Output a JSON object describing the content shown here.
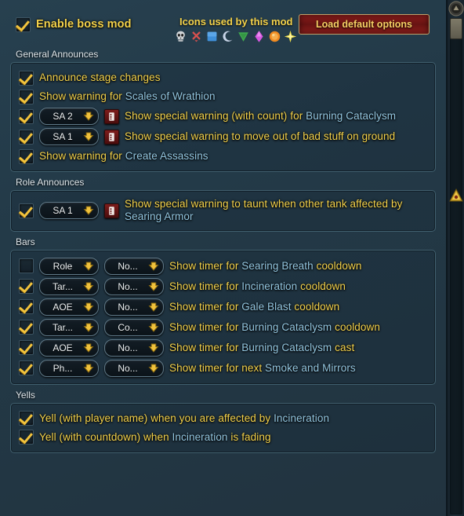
{
  "topbar": {
    "enable_label": "Enable boss mod",
    "enable_checked": true,
    "icons_title": "Icons used by this mod",
    "icons": [
      {
        "name": "skull-icon",
        "color": "#d9d9d9"
      },
      {
        "name": "cross-icon",
        "color": "#d8504e"
      },
      {
        "name": "square-icon",
        "color": "#3f8fd8"
      },
      {
        "name": "moon-icon",
        "color": "#c8d5e8"
      },
      {
        "name": "triangle-icon",
        "color": "#3fa84f"
      },
      {
        "name": "diamond-icon",
        "color": "#d659e0"
      },
      {
        "name": "circle-icon",
        "color": "#f08a20"
      },
      {
        "name": "star-icon",
        "color": "#f2e14a"
      }
    ],
    "load_defaults_label": "Load default options"
  },
  "sections": [
    {
      "title": "General Announces",
      "rows": [
        {
          "checked": true,
          "dropdowns": [],
          "note": false,
          "text_parts": [
            {
              "t": "Announce stage changes",
              "spell": false
            }
          ]
        },
        {
          "checked": true,
          "dropdowns": [],
          "note": false,
          "text_parts": [
            {
              "t": "Show warning for ",
              "spell": false
            },
            {
              "t": "Scales of Wrathion",
              "spell": true
            }
          ]
        },
        {
          "checked": true,
          "dropdowns": [
            {
              "name": "special-announce-type",
              "value": "SA 2",
              "width": "dd-sa"
            }
          ],
          "note": true,
          "text_parts": [
            {
              "t": "Show special warning (with count) for ",
              "spell": false
            },
            {
              "t": "Burning Cataclysm",
              "spell": true
            }
          ]
        },
        {
          "checked": true,
          "dropdowns": [
            {
              "name": "special-announce-type",
              "value": "SA 1",
              "width": "dd-sa"
            }
          ],
          "note": true,
          "text_parts": [
            {
              "t": "Show special warning to move out of bad stuff on ground",
              "spell": false
            }
          ]
        },
        {
          "checked": true,
          "dropdowns": [],
          "note": false,
          "text_parts": [
            {
              "t": "Show warning for ",
              "spell": false
            },
            {
              "t": "Create Assassins",
              "spell": true
            }
          ]
        }
      ]
    },
    {
      "title": "Role Announces",
      "rows": [
        {
          "checked": true,
          "dropdowns": [
            {
              "name": "special-announce-type",
              "value": "SA 1",
              "width": "dd-sa"
            }
          ],
          "note": true,
          "text_parts": [
            {
              "t": "Show special warning to taunt when other tank affected by ",
              "spell": false
            },
            {
              "t": "Searing Armor",
              "spell": true
            }
          ]
        }
      ]
    },
    {
      "title": "Bars",
      "rows": [
        {
          "checked": false,
          "dropdowns": [
            {
              "name": "bar-color-select",
              "value": "Role",
              "width": "dd-w1"
            },
            {
              "name": "bar-icon-select",
              "value": "No...",
              "width": "dd-w2"
            }
          ],
          "note": false,
          "text_parts": [
            {
              "t": "Show timer for ",
              "spell": false
            },
            {
              "t": "Searing Breath",
              "spell": true
            },
            {
              "t": " cooldown",
              "spell": false
            }
          ]
        },
        {
          "checked": true,
          "dropdowns": [
            {
              "name": "bar-color-select",
              "value": "Tar...",
              "width": "dd-w1"
            },
            {
              "name": "bar-icon-select",
              "value": "No...",
              "width": "dd-w2"
            }
          ],
          "note": false,
          "text_parts": [
            {
              "t": "Show timer for ",
              "spell": false
            },
            {
              "t": "Incineration",
              "spell": true
            },
            {
              "t": " cooldown",
              "spell": false
            }
          ]
        },
        {
          "checked": true,
          "dropdowns": [
            {
              "name": "bar-color-select",
              "value": "AOE",
              "width": "dd-w1"
            },
            {
              "name": "bar-icon-select",
              "value": "No...",
              "width": "dd-w2"
            }
          ],
          "note": false,
          "text_parts": [
            {
              "t": "Show timer for ",
              "spell": false
            },
            {
              "t": "Gale Blast",
              "spell": true
            },
            {
              "t": " cooldown",
              "spell": false
            }
          ]
        },
        {
          "checked": true,
          "dropdowns": [
            {
              "name": "bar-color-select",
              "value": "Tar...",
              "width": "dd-w1"
            },
            {
              "name": "bar-icon-select",
              "value": "Co...",
              "width": "dd-w2"
            }
          ],
          "note": false,
          "text_parts": [
            {
              "t": "Show timer for ",
              "spell": false
            },
            {
              "t": "Burning Cataclysm",
              "spell": true
            },
            {
              "t": " cooldown",
              "spell": false
            }
          ]
        },
        {
          "checked": true,
          "dropdowns": [
            {
              "name": "bar-color-select",
              "value": "AOE",
              "width": "dd-w1"
            },
            {
              "name": "bar-icon-select",
              "value": "No...",
              "width": "dd-w2"
            }
          ],
          "note": false,
          "text_parts": [
            {
              "t": "Show timer for ",
              "spell": false
            },
            {
              "t": "Burning Cataclysm",
              "spell": true
            },
            {
              "t": " cast",
              "spell": false
            }
          ]
        },
        {
          "checked": true,
          "dropdowns": [
            {
              "name": "bar-color-select",
              "value": "Ph...",
              "width": "dd-w1"
            },
            {
              "name": "bar-icon-select",
              "value": "No...",
              "width": "dd-w2"
            }
          ],
          "note": false,
          "text_parts": [
            {
              "t": "Show timer for next ",
              "spell": false
            },
            {
              "t": "Smoke and Mirrors",
              "spell": true
            }
          ]
        }
      ]
    },
    {
      "title": "Yells",
      "rows": [
        {
          "checked": true,
          "dropdowns": [],
          "note": false,
          "text_parts": [
            {
              "t": "Yell (with player name) when you are affected by ",
              "spell": false
            },
            {
              "t": "Incineration",
              "spell": true
            }
          ]
        },
        {
          "checked": true,
          "dropdowns": [],
          "note": false,
          "text_parts": [
            {
              "t": "Yell (with countdown) when ",
              "spell": false
            },
            {
              "t": "Incineration",
              "spell": true
            },
            {
              "t": " is fading",
              "spell": false
            }
          ]
        }
      ]
    }
  ],
  "scrollbar": {
    "up_arrow_name": "scroll-up-button",
    "thumb_name": "scroll-thumb",
    "marker_name": "scroll-position-marker"
  },
  "colors": {
    "label_yellow": "#f4d24a",
    "spell_blue": "#93c6e0",
    "panel_bg": "#233a48",
    "button_red": "#8e1d1c",
    "border_teal": "#41606f"
  }
}
